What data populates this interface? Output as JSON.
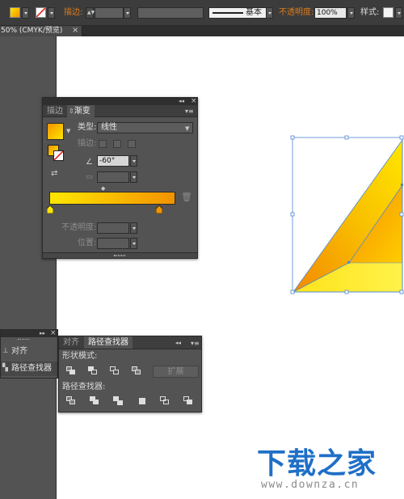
{
  "control_bar": {
    "stroke_label": "描边:",
    "stroke_style_value": "基本",
    "opacity_label": "不透明度:",
    "opacity_value": "100%",
    "style_label": "样式:",
    "fill_color": "#f7b400",
    "accent_orange": "#e07b1a"
  },
  "document_tab": {
    "title": "50% (CMYK/预览)",
    "close_glyph": "×"
  },
  "gradient_panel": {
    "collapse_glyph": "◂◂",
    "close_glyph": "×",
    "tabs": [
      {
        "label": "描边",
        "active": false
      },
      {
        "label": "渐变",
        "active": true
      }
    ],
    "menu_glyph": "▾≡",
    "type_label": "类型:",
    "type_value": "线性",
    "stroke_label": "描边:",
    "angle_value": "-60°",
    "opacity_label": "不透明度:",
    "position_label": "位置:",
    "gradient_start": "#ffe600",
    "gradient_end": "#f29300"
  },
  "align_panel": {
    "expand_glyph": "▸▸",
    "close_glyph": "×",
    "items": [
      {
        "label": "对齐"
      },
      {
        "label": "路径查找器"
      }
    ]
  },
  "pathfinder_panel": {
    "collapse_glyph": "◂◂",
    "close_glyph": "×",
    "tabs": [
      {
        "label": "对齐",
        "active": false
      },
      {
        "label": "路径查找器",
        "active": true
      }
    ],
    "menu_glyph": "▾≡",
    "shape_modes_label": "形状模式:",
    "expand_button": "扩展",
    "pathfinders_label": "路径查找器:"
  },
  "watermark": {
    "title": "下载之家",
    "url": "www.downza.cn"
  }
}
